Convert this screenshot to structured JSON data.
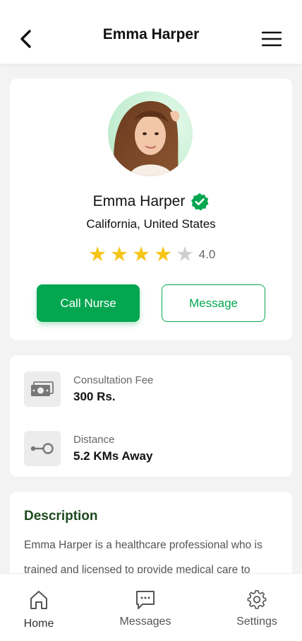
{
  "header": {
    "title": "Emma Harper",
    "back_icon": "chevron-left-icon",
    "menu_icon": "hamburger-menu-icon"
  },
  "profile": {
    "name": "Emma Harper",
    "verified": true,
    "location": "California, United States",
    "rating": {
      "value": "4.0",
      "stars_filled": 4,
      "stars_total": 5
    },
    "call_button": "Call Nurse",
    "message_button": "Message"
  },
  "info": {
    "fee": {
      "label": "Consultation Fee",
      "value": "300 Rs.",
      "icon": "cash-icon"
    },
    "distance": {
      "label": "Distance",
      "value": "5.2 KMs Away",
      "icon": "route-icon"
    }
  },
  "description": {
    "title": "Description",
    "text": "Emma Harper is a healthcare professional who is trained and licensed to provide medical care to"
  },
  "nav": {
    "items": [
      {
        "label": "Home",
        "icon": "home-icon",
        "active": true
      },
      {
        "label": "Messages",
        "icon": "chat-icon",
        "active": false
      },
      {
        "label": "Settings",
        "icon": "gear-icon",
        "active": false
      }
    ]
  },
  "colors": {
    "accent": "#05a650",
    "star": "#f5c518",
    "star_empty": "#cfcfcf",
    "description_title": "#1e4a1e",
    "background": "#f3f3f3"
  }
}
